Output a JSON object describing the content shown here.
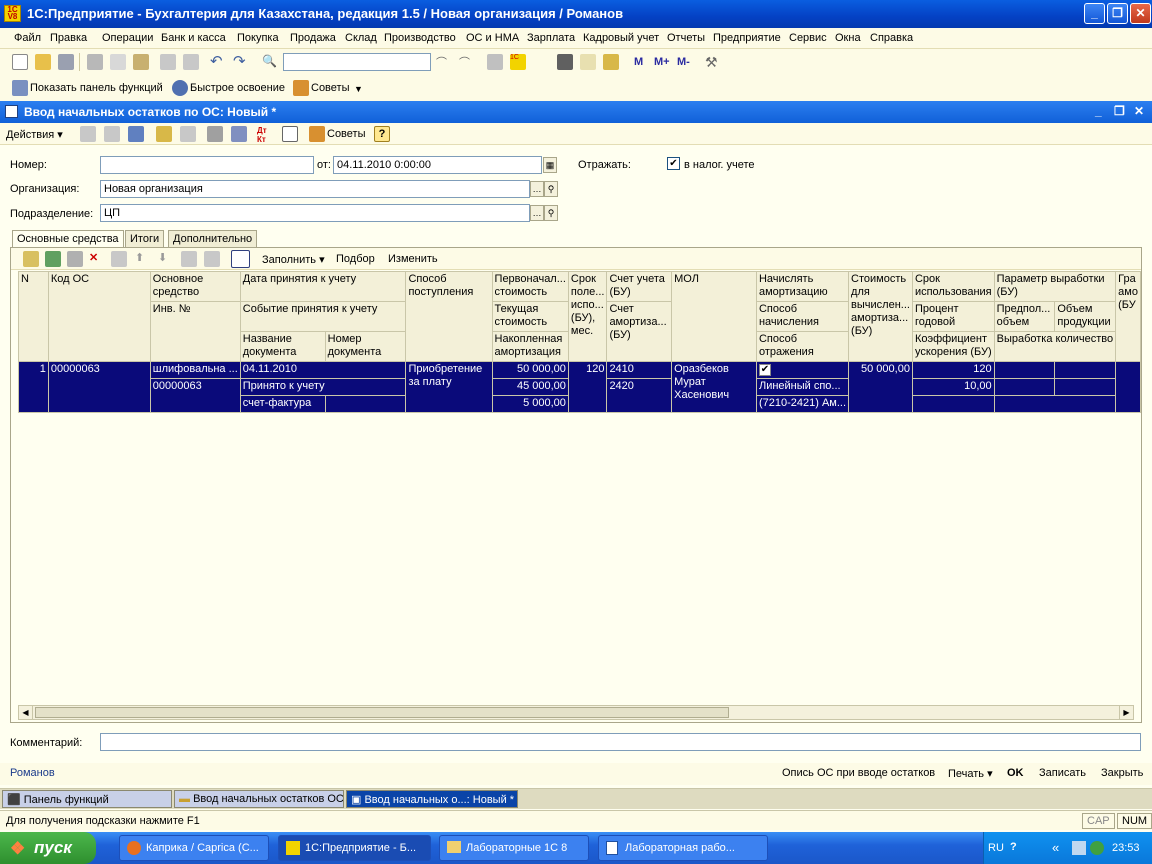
{
  "app": {
    "title": "1С:Предприятие - Бухгалтерия для Казахстана, редакция 1.5 / Новая организация / Романов",
    "icon_text": "1C V8"
  },
  "menu": [
    "Файл",
    "Правка",
    "Операции",
    "Банк и касса",
    "Покупка",
    "Продажа",
    "Склад",
    "Производство",
    "ОС и НМА",
    "Зарплата",
    "Кадровый учет",
    "Отчеты",
    "Предприятие",
    "Сервис",
    "Окна",
    "Справка"
  ],
  "toolbar3": {
    "show_panel": "Показать панель функций",
    "quick": "Быстрое освоение",
    "tips": "Советы"
  },
  "toolbar2": {
    "m1": "М",
    "m2": "М+",
    "m3": "М-"
  },
  "doc": {
    "title": "Ввод начальных остатков по ОС: Новый *",
    "actions": "Действия",
    "tips": "Советы"
  },
  "form": {
    "number_label": "Номер:",
    "number": "",
    "date_label": "от:",
    "date": "04.11.2010  0:00:00",
    "reflect_label": "Отражать:",
    "tax_label": "в налог. учете",
    "org_label": "Организация:",
    "org": "Новая организация",
    "dept_label": "Подразделение:",
    "dept": "ЦП",
    "comment_label": "Комментарий:",
    "comment": ""
  },
  "tabs": [
    "Основные средства",
    "Итоги",
    "Дополнительно"
  ],
  "gridbar": {
    "fill": "Заполнить",
    "pick": "Подбор",
    "edit": "Изменить"
  },
  "headers": {
    "n": "N",
    "code": "Код ОС",
    "os": "Основное средство",
    "inv": "Инв. №",
    "date": "Дата принятия к учету",
    "event": "Событие принятия к учету",
    "docname": "Название документа",
    "docnum": "Номер документа",
    "method": "Способ поступления",
    "initial": "Первоначал... стоимость",
    "current": "Текущая стоимость",
    "accum": "Накопленная амортизация",
    "term": "Срок поле... испо... (БУ), мес.",
    "acc": "Счет учета (БУ)",
    "accam": "Счет амортиза... (БУ)",
    "mol": "МОЛ",
    "amort": "Начислять амортизацию",
    "amethod": "Способ начисления",
    "reflect": "Способ отражения",
    "costcalc": "Стоимость для вычислен... амортиза... (БУ)",
    "useterm": "Срок использования",
    "pct": "Процент годовой",
    "coef": "Коэффициент ускорения (БУ)",
    "param": "Параметр выработки (БУ)",
    "planned": "Предпол... объем",
    "volume": "Объем продукции",
    "output": "Выработка количество",
    "gra": "Гра амо (БУ"
  },
  "row": {
    "n": "1",
    "code": "00000063",
    "os": "шлифовальна ...",
    "inv": "00000063",
    "date": "04.11.2010",
    "event": "Принято к учету",
    "docname": "счет-фактура",
    "method": "Приобретение за плату",
    "initial": "50 000,00",
    "current": "45 000,00",
    "accum": "5 000,00",
    "term": "120",
    "acc": "2410",
    "accam": "2420",
    "mol": "Оразбеков Мурат Хасенович",
    "amort": "✔",
    "amethod": "Линейный спо...",
    "reflect": "(7210-2421) Ам...",
    "costcalc": "50 000,00",
    "useterm": "120",
    "pct": "10,00"
  },
  "bottom": {
    "user": "Романов",
    "desc": "Опись ОС при вводе остатков",
    "print": "Печать",
    "ok": "OK",
    "save": "Записать",
    "close": "Закрыть"
  },
  "wintabs": [
    "Панель функций",
    "Ввод начальных остатков ОС",
    "Ввод начальных о...: Новый *"
  ],
  "status": {
    "hint": "Для получения подсказки нажмите F1",
    "cap": "CAP",
    "num": "NUM"
  },
  "taskbar": {
    "start": "пуск",
    "tasks": [
      "Каприка / Caprica (С...",
      "1С:Предприятие - Б...",
      "Лабораторные 1С 8",
      "Лабораторная рабо..."
    ],
    "lang": "RU",
    "time": "23:53"
  }
}
